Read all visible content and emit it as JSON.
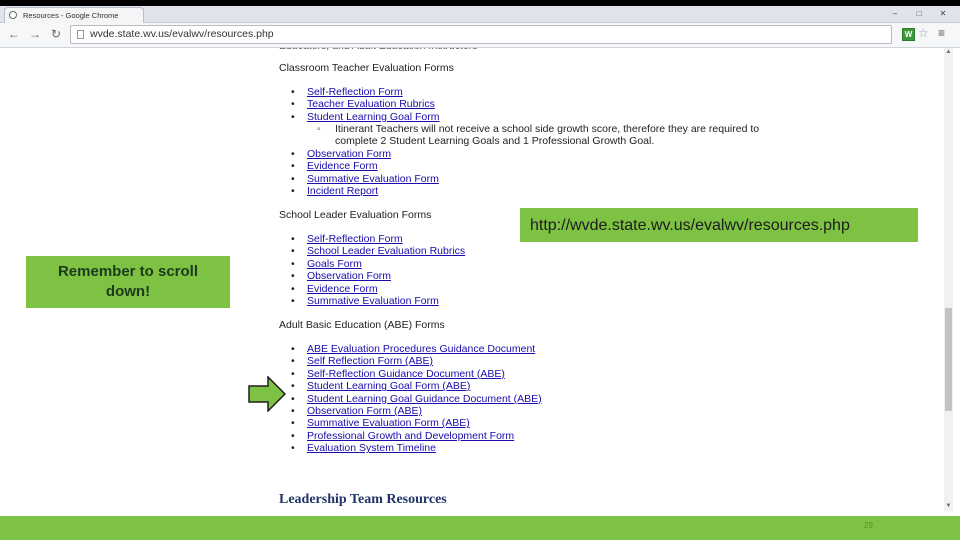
{
  "browser": {
    "tab_title": "Resources - Google Chrome",
    "url": "wvde.state.wv.us/evalwv/resources.php",
    "window_buttons": [
      "–",
      "□",
      "✕"
    ],
    "back_icon": "back-arrow-icon",
    "forward_icon": "forward-arrow-icon",
    "reload_icon": "reload-icon",
    "extension_label": "W"
  },
  "page": {
    "cut_heading": "Educators, and Adult Education Instructors",
    "sections": [
      {
        "title": "Classroom Teacher Evaluation Forms",
        "items": [
          {
            "label": "Self-Reflection Form",
            "link": true
          },
          {
            "label": "Teacher Evaluation Rubrics",
            "link": true
          },
          {
            "label": "Student Learning Goal Form",
            "link": true
          },
          {
            "label": "Observation Form",
            "link": true
          },
          {
            "label": "Evidence Form",
            "link": true
          },
          {
            "label": "Summative Evaluation Form",
            "link": true
          },
          {
            "label": "Incident Report",
            "link": true
          }
        ],
        "subnote": "Itinerant Teachers will not receive a school side growth score, therefore they are required to complete 2 Student Learning Goals and 1 Professional Growth Goal."
      },
      {
        "title": "School Leader Evaluation Forms",
        "items": [
          {
            "label": "Self-Reflection Form",
            "link": true
          },
          {
            "label": "School Leader Evaluation Rubrics",
            "link": true
          },
          {
            "label": "Goals Form",
            "link": true
          },
          {
            "label": "Observation Form",
            "link": true
          },
          {
            "label": "Evidence Form",
            "link": true
          },
          {
            "label": "Summative Evaluation Form",
            "link": true
          }
        ]
      },
      {
        "title": "Adult Basic Education (ABE) Forms",
        "items": [
          {
            "label": "ABE Evaluation Procedures Guidance Document",
            "link": true
          },
          {
            "label": "Self Reflection Form (ABE)",
            "link": true
          },
          {
            "label": "Self-Reflection Guidance Document (ABE)",
            "link": true
          },
          {
            "label": "Student Learning Goal Form (ABE)",
            "link": true
          },
          {
            "label": "Student Learning Goal Guidance Document (ABE)",
            "link": true
          },
          {
            "label": "Observation Form (ABE)",
            "link": true
          },
          {
            "label": "Summative Evaluation Form (ABE)",
            "link": true
          },
          {
            "label": "Professional Growth and Development Form",
            "link": true
          },
          {
            "label": "Evaluation System Timeline",
            "link": true
          }
        ]
      }
    ],
    "leadership_heading": "Leadership Team Resources"
  },
  "overlay": {
    "scroll_note_line1": "Remember to scroll",
    "scroll_note_line2": "down!",
    "url_note": "http://wvde.state.wv.us/evalwv/resources.php",
    "slide_number": "29"
  },
  "colors": {
    "green": "#7dc242",
    "link": "#1a0dab",
    "heading_navy": "#1f3466"
  }
}
